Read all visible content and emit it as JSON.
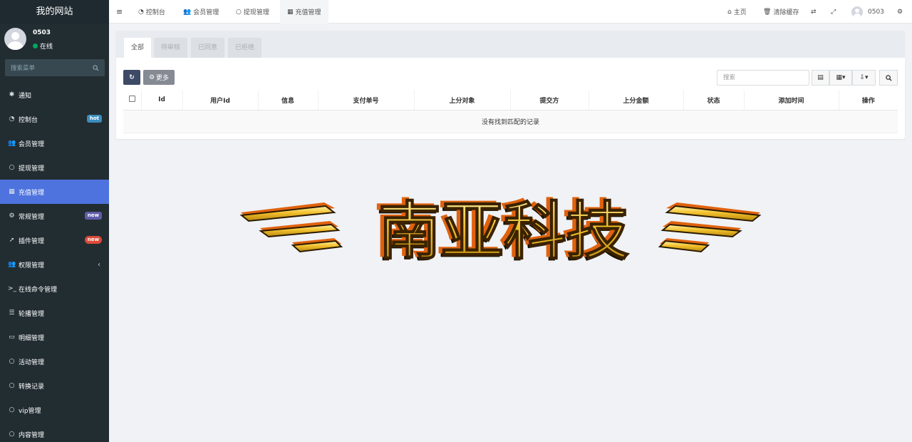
{
  "sidebar": {
    "brand": "我的网站",
    "user": {
      "name": "0503",
      "status": "在线"
    },
    "search_placeholder": "搜索菜单",
    "items": [
      {
        "label": "通知",
        "icon": "gear-star-icon"
      },
      {
        "label": "控制台",
        "icon": "dashboard-icon",
        "badge": "hot",
        "badge_color": "#3c8dbc"
      },
      {
        "label": "会员管理",
        "icon": "users-icon"
      },
      {
        "label": "提现管理",
        "icon": "circle-icon"
      },
      {
        "label": "充值管理",
        "icon": "grid-icon",
        "active": true
      },
      {
        "label": "常规管理",
        "icon": "cogs-icon",
        "badge": "new",
        "badge_color": "#605ca8"
      },
      {
        "label": "插件管理",
        "icon": "rocket-icon",
        "badge": "new",
        "badge_color": "#dd4b39"
      },
      {
        "label": "权限管理",
        "icon": "users-icon",
        "has_arrow": true
      },
      {
        "label": "在线命令管理",
        "icon": "terminal-icon"
      },
      {
        "label": "轮播管理",
        "icon": "list-icon"
      },
      {
        "label": "明细管理",
        "icon": "calendar-icon"
      },
      {
        "label": "活动管理",
        "icon": "circle-icon"
      },
      {
        "label": "转换记录",
        "icon": "circle-icon"
      },
      {
        "label": "vip管理",
        "icon": "circle-icon"
      },
      {
        "label": "内容管理",
        "icon": "circle-icon"
      }
    ]
  },
  "topbar": {
    "tabs": [
      {
        "label": "控制台",
        "icon": "dashboard-icon"
      },
      {
        "label": "会员管理",
        "icon": "users-icon"
      },
      {
        "label": "提现管理",
        "icon": "circle-icon"
      },
      {
        "label": "充值管理",
        "icon": "grid-icon",
        "active": true
      }
    ],
    "home": "主页",
    "clear_cache": "清除缓存",
    "username": "0503"
  },
  "panel": {
    "tabs": [
      "全部",
      "待审核",
      "已同意",
      "已拒绝"
    ],
    "more_button": "更多",
    "search_placeholder": "搜索",
    "columns": [
      "Id",
      "用户Id",
      "信息",
      "支付单号",
      "上分对象",
      "提交方",
      "上分金额",
      "状态",
      "添加时间",
      "操作"
    ],
    "empty_text": "没有找到匹配的记录"
  },
  "logo": {
    "text": "南亚科技"
  },
  "colors": {
    "sidebar_bg": "#222d32",
    "active_menu": "#4e73df",
    "refresh_button": "#3d4a66",
    "more_button": "#858a93",
    "logo_gold": "#f2c12e",
    "logo_orange": "#e0620f"
  }
}
